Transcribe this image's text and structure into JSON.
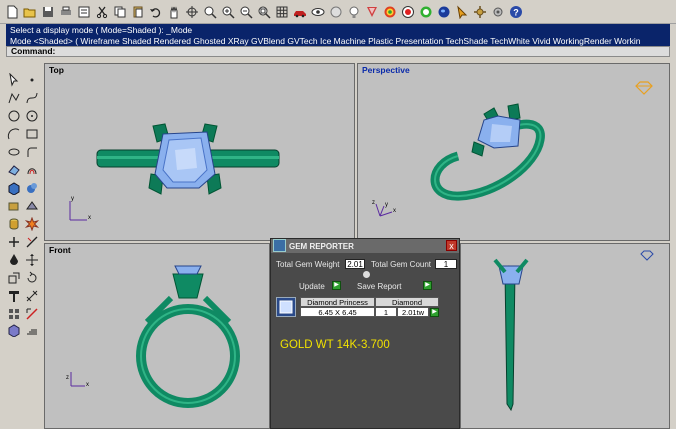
{
  "toolbar": {
    "icons": [
      "new-file",
      "open-folder",
      "save",
      "print",
      "copy-props",
      "cut",
      "copy",
      "paste",
      "undo",
      "pan-hand",
      "rotate",
      "zoom-window",
      "zoom-in",
      "zoom-out",
      "zoom-extents",
      "grid",
      "car",
      "eye",
      "transparent",
      "lightbulb",
      "material",
      "color-sphere",
      "render",
      "environment",
      "globe",
      "arrow",
      "settings",
      "gear-options",
      "help"
    ],
    "help_label": "?"
  },
  "command_history": {
    "line1": "Select a display mode ( Mode=Shaded ): _Mode",
    "line2": "Mode <Shaded> ( Wireframe  Shaded  Rendered  Ghosted  XRay  GVBlend  GVTech  Ice  Machine  Plastic  Presentation  TechShade  TechWhite  Vivid  WorkingRender  Workin"
  },
  "command_prompt": "Command:",
  "viewports": {
    "top": {
      "title": "Top",
      "axis_x": "x",
      "axis_y": "y"
    },
    "perspective": {
      "title": "Perspective",
      "axis_x": "x",
      "axis_y": "y",
      "axis_z": "z"
    },
    "front": {
      "title": "Front",
      "axis_x": "x",
      "axis_z": "z"
    }
  },
  "gem_reporter": {
    "title": "GEM REPORTER",
    "close": "x",
    "total_weight_label": "Total Gem Weight",
    "total_weight_value": "2.01",
    "total_count_label": "Total Gem Count",
    "total_count_value": "1",
    "update_label": "Update",
    "save_report_label": "Save Report",
    "table": {
      "col1": "Diamond Princess",
      "col2": "Diamond",
      "size": "6.45 X 6.45",
      "qty": "1",
      "carat": "2.01tw"
    },
    "annotation": "GOLD WT 14K-3.700"
  },
  "colors": {
    "metal": "#0f8a63",
    "metal_dark": "#085a40",
    "gem": "#8ab0ee",
    "gem_dark": "#4a74c8",
    "viewport_bg": "#c0c0c0",
    "history_bg": "#0a246a",
    "dialog_bg": "#4a4a4a",
    "gold_text": "#f2e200"
  }
}
